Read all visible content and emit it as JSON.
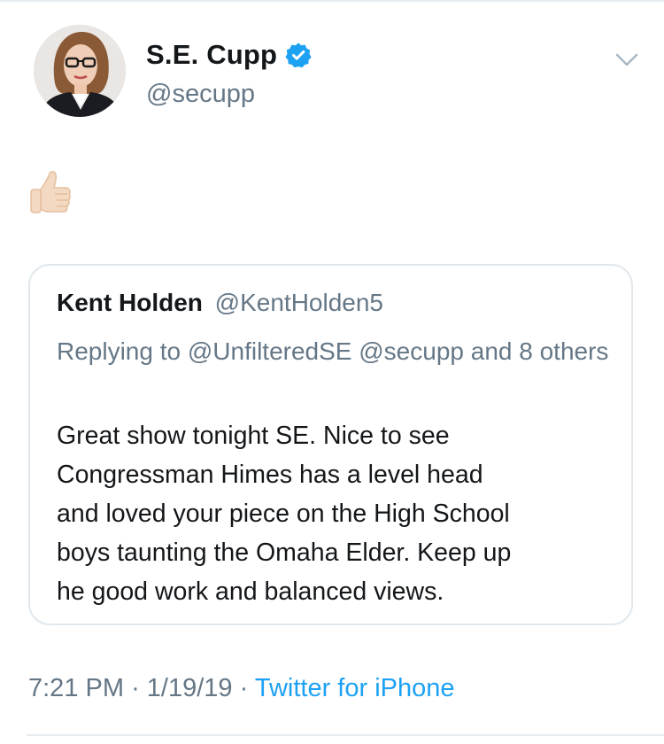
{
  "tweet": {
    "author": {
      "display_name": "S.E. Cupp",
      "handle": "@secupp",
      "verified": true
    },
    "body_emoji": "thumbs-up-light-skin-tone",
    "quoted": {
      "name": "Kent Holden",
      "handle": "@KentHolden5",
      "reply_context": "Replying to @UnfilteredSE @secupp and 8 others",
      "text_lines": [
        "Great show tonight SE. Nice to see",
        "Congressman Himes has a level head",
        "and loved your piece on the High School",
        "boys taunting the Omaha Elder. Keep up",
        "he good work and balanced views."
      ]
    },
    "footer": {
      "time": "7:21 PM",
      "separator": "·",
      "date": "1/19/19",
      "source": "Twitter for iPhone"
    }
  },
  "colors": {
    "primary_text": "#14171a",
    "secondary_text": "#657786",
    "link": "#1da1f2",
    "border": "#e1e8ed"
  },
  "icons": {
    "verified": "verified-badge-icon",
    "menu": "chevron-down-icon"
  }
}
